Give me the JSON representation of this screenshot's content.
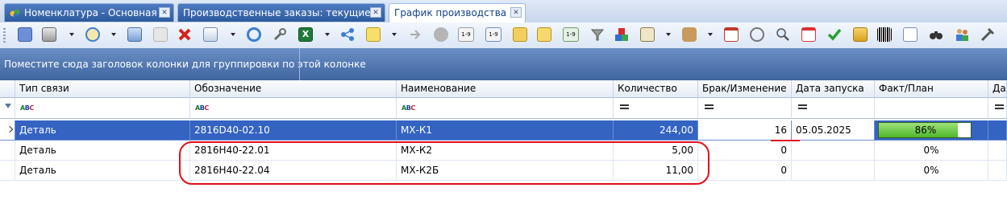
{
  "tabs": [
    {
      "label": "Номенклатура - Основная",
      "icon": "nomenclature-icon",
      "active": false
    },
    {
      "label": "Производственные заказы: текущие",
      "icon": "",
      "active": false
    },
    {
      "label": "График производства",
      "icon": "",
      "active": true
    }
  ],
  "group_panel": {
    "text": "Поместите сюда заголовок колонки для группировки по этой колонке"
  },
  "columns": [
    {
      "label": "Тип связи"
    },
    {
      "label": "Обозначение"
    },
    {
      "label": "Наименование"
    },
    {
      "label": "Количество"
    },
    {
      "label": "Брак/Изменение"
    },
    {
      "label": "Дата запуска"
    },
    {
      "label": "Факт/План"
    },
    {
      "label": "Да"
    }
  ],
  "rows": [
    {
      "type": "Деталь",
      "designation": "2816D40-02.10",
      "name": "МХ-К1",
      "qty": "244,00",
      "defect": "16",
      "start": "05.05.2025",
      "progress_label": "86%",
      "progress": 0.86,
      "selected": true
    },
    {
      "type": "Деталь",
      "designation": "2816H40-22.01",
      "name": "МХ-К2",
      "qty": "5,00",
      "defect": "0",
      "start": "",
      "progress_label": "0%",
      "progress": 0,
      "selected": false
    },
    {
      "type": "Деталь",
      "designation": "2816H40-22.04",
      "name": "МХ-К2Б",
      "qty": "11,00",
      "defect": "0",
      "start": "",
      "progress_label": "0%",
      "progress": 0,
      "selected": false
    }
  ],
  "colors": {
    "selection": "#3463c2",
    "annotation": "#e0101a",
    "progress": "#4fb72a"
  }
}
